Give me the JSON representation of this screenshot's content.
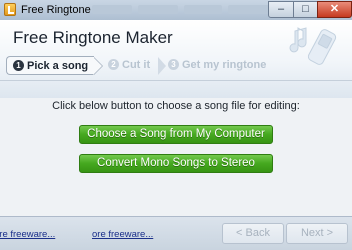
{
  "window": {
    "title": "Free Ringtone Maker"
  },
  "titlebar": {
    "minimize_glyph": "–",
    "maximize_glyph": "□",
    "close_glyph": "✕"
  },
  "header": {
    "title": "Free Ringtone Maker"
  },
  "steps": [
    {
      "number": "1",
      "label": "Pick a song"
    },
    {
      "number": "2",
      "label": "Cut it"
    },
    {
      "number": "3",
      "label": "Get my ringtone"
    }
  ],
  "main": {
    "prompt": "Click below button to choose a song file for editing:",
    "choose_button": "Choose a Song from My Computer",
    "convert_button": "Convert Mono Songs to Stereo"
  },
  "footer": {
    "link1": "ore freeware...",
    "link2": "ore freeware...",
    "back_button": "< Back",
    "next_button": "Next >"
  }
}
